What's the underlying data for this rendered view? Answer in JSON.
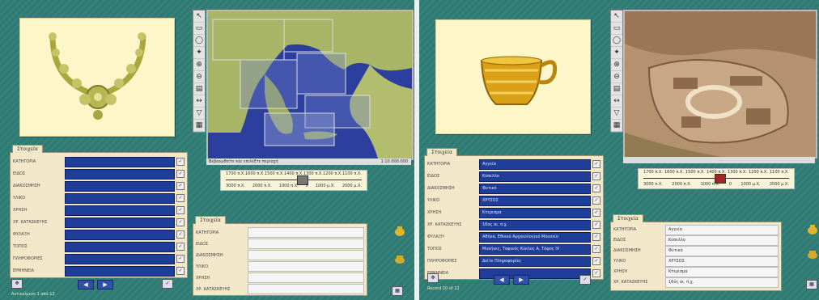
{
  "left": {
    "form_tab_label": "Στοιχεία",
    "form_rows": [
      {
        "label": "ΚΑΤΗΓΟΡΙΑ",
        "value": ""
      },
      {
        "label": "ΕΙΔΟΣ",
        "value": ""
      },
      {
        "label": "ΔΙΑΚΟΣΜΗΣΗ",
        "value": ""
      },
      {
        "label": "ΥΛΙΚΟ",
        "value": ""
      },
      {
        "label": "ΧΡΗΣΗ",
        "value": ""
      },
      {
        "label": "ΧΡ. ΚΑΤΑΣΚΕΥΗΣ",
        "value": ""
      },
      {
        "label": "ΦΥΛΑΞΗ",
        "value": ""
      },
      {
        "label": "ΤΟΠΟΣ",
        "value": ""
      },
      {
        "label": "ΠΛΗΡΟΦΟΡΙΕΣ",
        "value": ""
      },
      {
        "label": "ΕΡΜΗΝΕΙΑ",
        "value": ""
      }
    ],
    "status_text": "Αντικείμενο 1 από 12",
    "map_status": "Βεβαιωθείτε και επιλέξτε περιοχή",
    "map_zoom": "1:10.000.000",
    "timeline_top": [
      "1700 π.Χ.",
      "1600 π.Χ.",
      "1500 π.Χ.",
      "1400 π.Χ.",
      "1300 π.Χ.",
      "1200 π.Χ.",
      "1100 π.Χ."
    ],
    "timeline_bottom": [
      "3000 π.Χ.",
      "2000 π.Χ.",
      "1000 π.Χ.",
      "0",
      "1000 μ.Χ.",
      "2000 μ.Χ."
    ],
    "timeline_position": 0.56,
    "detail_tab_label": "Στοιχεία",
    "detail_rows": [
      {
        "label": "ΚΑΤΗΓΟΡΙΑ",
        "value": ""
      },
      {
        "label": "ΕΙΔΟΣ",
        "value": ""
      },
      {
        "label": "ΔΙΑΚΟΣΜΗΣΗ",
        "value": ""
      },
      {
        "label": "ΥΛΙΚΟ",
        "value": ""
      },
      {
        "label": "ΧΡΗΣΗ",
        "value": ""
      },
      {
        "label": "ΧΡ. ΚΑΤΑΣΚΕΥΗΣ",
        "value": ""
      }
    ]
  },
  "right": {
    "form_tab_label": "Στοιχεία",
    "form_rows": [
      {
        "label": "ΚΑΤΗΓΟΡΙΑ",
        "value": "Αγγεία"
      },
      {
        "label": "ΕΙΔΟΣ",
        "value": "Κύπελλο"
      },
      {
        "label": "ΔΙΑΚΟΣΜΗΣΗ",
        "value": "Φυτικό"
      },
      {
        "label": "ΥΛΙΚΟ",
        "value": "ΧΡΥΣΟΣ"
      },
      {
        "label": "ΧΡΗΣΗ",
        "value": "Κτερισμα"
      },
      {
        "label": "ΧΡ. ΚΑΤΑΣΚΕΥΗΣ",
        "value": "16ος αι. π.χ."
      },
      {
        "label": "ΦΥΛΑΞΗ",
        "value": "Αθήνα, Εθνικό Αρχαιολογικό Μουσείο"
      },
      {
        "label": "ΤΟΠΟΣ",
        "value": "Μυκήνες, Ταφικός Κύκλος Α, Τάφος IV"
      },
      {
        "label": "ΠΛΗΡΟΦΟΡΙΕΣ",
        "value": "Δείτε Πληροφορίες"
      },
      {
        "label": "ΕΡΜΗΝΕΙΑ",
        "value": ""
      }
    ],
    "status_text": "Record 10 of 12",
    "timeline_top": [
      "1700 π.Χ.",
      "1600 π.Χ.",
      "1500 π.Χ.",
      "1400 π.Χ.",
      "1300 π.Χ.",
      "1200 π.Χ.",
      "1100 π.Χ."
    ],
    "timeline_bottom": [
      "3000 π.Χ.",
      "2000 π.Χ.",
      "1000 π.Χ.",
      "0",
      "1000 μ.Χ.",
      "2000 μ.Χ."
    ],
    "timeline_position": 0.52,
    "detail_tab_label": "Στοιχεία",
    "detail_rows": [
      {
        "label": "ΚΑΤΗΓΟΡΙΑ",
        "value": "Αγγεία"
      },
      {
        "label": "ΕΙΔΟΣ",
        "value": "Κύπελλο"
      },
      {
        "label": "ΔΙΑΚΟΣΜΗΣΗ",
        "value": "Φυτικό"
      },
      {
        "label": "ΥΛΙΚΟ",
        "value": "ΧΡΥΣΟΣ"
      },
      {
        "label": "ΧΡΗΣΗ",
        "value": "Κτερισμα"
      },
      {
        "label": "ΧΡ. ΚΑΤΑΣΚΕΥΗΣ",
        "value": "16ος αι. π.χ."
      }
    ]
  },
  "toolbar_icons": [
    "arrow-icon",
    "rect-select-icon",
    "lasso-icon",
    "pin-icon",
    "zoom-in-icon",
    "zoom-out-icon",
    "layers-icon",
    "measure-icon",
    "filter-icon",
    "print-icon"
  ],
  "toolbar_glyphs": [
    "↖",
    "▭",
    "◯",
    "✦",
    "⊕",
    "⊖",
    "▤",
    "↔",
    "▽",
    "▦"
  ],
  "colors": {
    "background": "#2f7d76",
    "panel": "#f2e8c9",
    "field": "#1f3e9a",
    "gold": "#c9a21e"
  }
}
